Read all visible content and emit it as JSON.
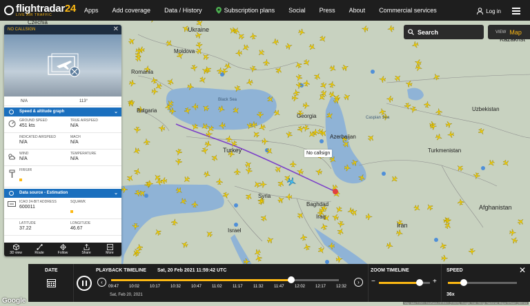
{
  "brand": {
    "name_a": "flightradar",
    "name_b": "24",
    "tagline": "LIVE AIR TRAFFIC"
  },
  "nav": [
    {
      "label": "Apps"
    },
    {
      "label": "Add coverage"
    },
    {
      "label": "Data / History"
    },
    {
      "label": "Subscription plans",
      "icon": "map-pin-icon"
    },
    {
      "label": "Social"
    },
    {
      "label": "Press"
    },
    {
      "label": "About"
    },
    {
      "label": "Commercial services"
    }
  ],
  "account": {
    "login_label": "Log in"
  },
  "search": {
    "label": "Search"
  },
  "view": {
    "label": "VIEW",
    "value": "Map"
  },
  "map": {
    "countries": [
      {
        "name": "Czechia"
      },
      {
        "name": "Ukraine"
      },
      {
        "name": "Moldova"
      },
      {
        "name": "Romania"
      },
      {
        "name": "Bulgaria"
      },
      {
        "name": "Black Sea"
      },
      {
        "name": "Georgia"
      },
      {
        "name": "Caspian Sea"
      },
      {
        "name": "Azerbaijan"
      },
      {
        "name": "Turkey"
      },
      {
        "name": "Syria"
      },
      {
        "name": "Baghdad"
      },
      {
        "name": "Iraq"
      },
      {
        "name": "Iran"
      },
      {
        "name": "Israel"
      },
      {
        "name": "Uzbekistan"
      },
      {
        "name": "Turkmenistan"
      },
      {
        "name": "Afghanistan"
      },
      {
        "name": "Kazakhst"
      }
    ],
    "selected_label": "No callsign"
  },
  "panel": {
    "callsign": "NO CALLSIGN",
    "summary_row": [
      "N/A",
      "113°"
    ],
    "speed_section_title": "Speed & altitude graph",
    "ground_speed_label": "GROUND SPEED",
    "ground_speed_value": "451 kts",
    "true_airspeed_label": "TRUE AIRSPEED",
    "true_airspeed_value": "N/A",
    "indicated_airspeed_label": "INDICATED AIRSPEED",
    "indicated_airspeed_value": "N/A",
    "mach_label": "MACH",
    "mach_value": "N/A",
    "wind_label": "WIND",
    "wind_value": "N/A",
    "temperature_label": "TEMPERATURE",
    "temperature_value": "N/A",
    "fir_label": "FIR/UIR",
    "source_section_title": "Data source - Estimation",
    "icao_label": "ICAO 24-BIT ADDRESS",
    "icao_value": "600011",
    "squawk_label": "SQUAWK",
    "latitude_label": "LATITUDE",
    "latitude_value": "37.22",
    "longitude_label": "LONGITUDE",
    "longitude_value": "46.67",
    "tools": [
      {
        "label": "3D view",
        "icon": "cube-icon"
      },
      {
        "label": "Route",
        "icon": "route-icon"
      },
      {
        "label": "Follow",
        "icon": "crosshair-icon"
      },
      {
        "label": "Share",
        "icon": "share-icon"
      },
      {
        "label": "More",
        "icon": "more-icon"
      }
    ]
  },
  "playback": {
    "date_label": "DATE",
    "timeline_title": "PLAYBACK TIMELINE",
    "current_datetime": "Sat, 20 Feb 2021 11:59:42 UTC",
    "ticks": [
      "09:47",
      "10:02",
      "10:17",
      "10:32",
      "10:47",
      "11:02",
      "11:17",
      "11:32",
      "11:47",
      "12:02",
      "12:17",
      "12:32"
    ],
    "day_label": "Sat, Feb 20, 2021",
    "timeline_position": 0.79,
    "zoom_title": "ZOOM TIMELINE",
    "zoom_level": 0.8,
    "speed_title": "SPEED",
    "speed_value": "36x",
    "speed_level": 0.23
  },
  "footer": {
    "google": "Google",
    "attribution": "Map data ©2021 GeoBasis-DE/BKG (©2009), Google, Inst. Geogr. Nacional, Mapa GISrael | 500 km"
  },
  "colors": {
    "accent": "#fdb913",
    "panel_section": "#1a6fbe",
    "land": "#c8d2c0",
    "water": "#8fb3d6",
    "plane": "#f5d000",
    "track": "#7b3fc8"
  }
}
